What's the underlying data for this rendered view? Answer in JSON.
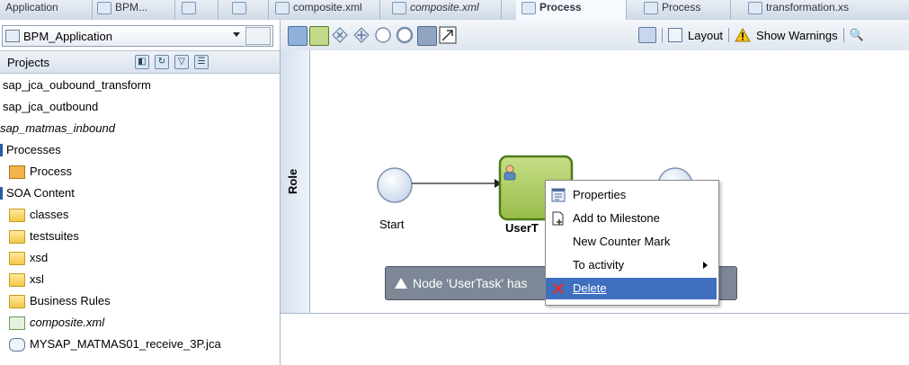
{
  "tabs": [
    {
      "label": "Application",
      "active": false
    },
    {
      "label": "BPM...",
      "active": false
    },
    {
      "label": "",
      "active": false
    },
    {
      "label": "",
      "active": false
    },
    {
      "label": "composite.xml",
      "active": false
    },
    {
      "label": "composite.xml",
      "active": false
    },
    {
      "label": "Process",
      "active": true
    },
    {
      "label": "Process",
      "active": false
    },
    {
      "label": "transformation.xs",
      "active": false
    }
  ],
  "left_panel": {
    "app_combo": "BPM_Application",
    "projects_label": "Projects",
    "tree": [
      {
        "label": "sap_jca_oubound_transform",
        "icon": "none",
        "italic": false
      },
      {
        "label": "sap_jca_outbound",
        "icon": "none",
        "italic": false
      },
      {
        "label": "sap_matmas_inbound",
        "icon": "none",
        "italic": true
      },
      {
        "label": "Processes",
        "icon": "none",
        "italic": false
      },
      {
        "label": "Process",
        "icon": "process-icon",
        "italic": false
      },
      {
        "label": "SOA Content",
        "icon": "none",
        "italic": false
      },
      {
        "label": "classes",
        "icon": "folder-icon",
        "italic": false
      },
      {
        "label": "testsuites",
        "icon": "folder-icon",
        "italic": false
      },
      {
        "label": "xsd",
        "icon": "folder-icon",
        "italic": false
      },
      {
        "label": "xsl",
        "icon": "folder-icon",
        "italic": false
      },
      {
        "label": "Business Rules",
        "icon": "folder-icon",
        "italic": false
      },
      {
        "label": "composite.xml",
        "icon": "composite-icon",
        "italic": true
      },
      {
        "label": "MYSAP_MATMAS01_receive_3P.jca",
        "icon": "jca-file-icon",
        "italic": false
      }
    ]
  },
  "editor": {
    "toolbar_right": {
      "layout": "Layout",
      "warnings": "Show Warnings"
    },
    "lane_label": "Role",
    "nodes": {
      "start_label": "Start",
      "task_label": "UserT"
    },
    "warning_text": "Node 'UserTask' has",
    "context_menu": [
      {
        "label": "Properties",
        "icon": "properties-icon",
        "submenu": false,
        "selected": false
      },
      {
        "label": "Add to Milestone",
        "icon": "milestone-icon",
        "submenu": false,
        "selected": false
      },
      {
        "label": "New Counter Mark",
        "icon": "",
        "submenu": false,
        "selected": false
      },
      {
        "label": "To activity",
        "icon": "",
        "submenu": true,
        "selected": false
      },
      {
        "label": "Delete",
        "icon": "delete-icon",
        "submenu": false,
        "selected": true
      }
    ]
  },
  "colors": {
    "selection": "#3f6fbf",
    "task_fill": "#a9c95a",
    "task_border": "#4e7a1c",
    "warning_bg": "#7d8795"
  }
}
